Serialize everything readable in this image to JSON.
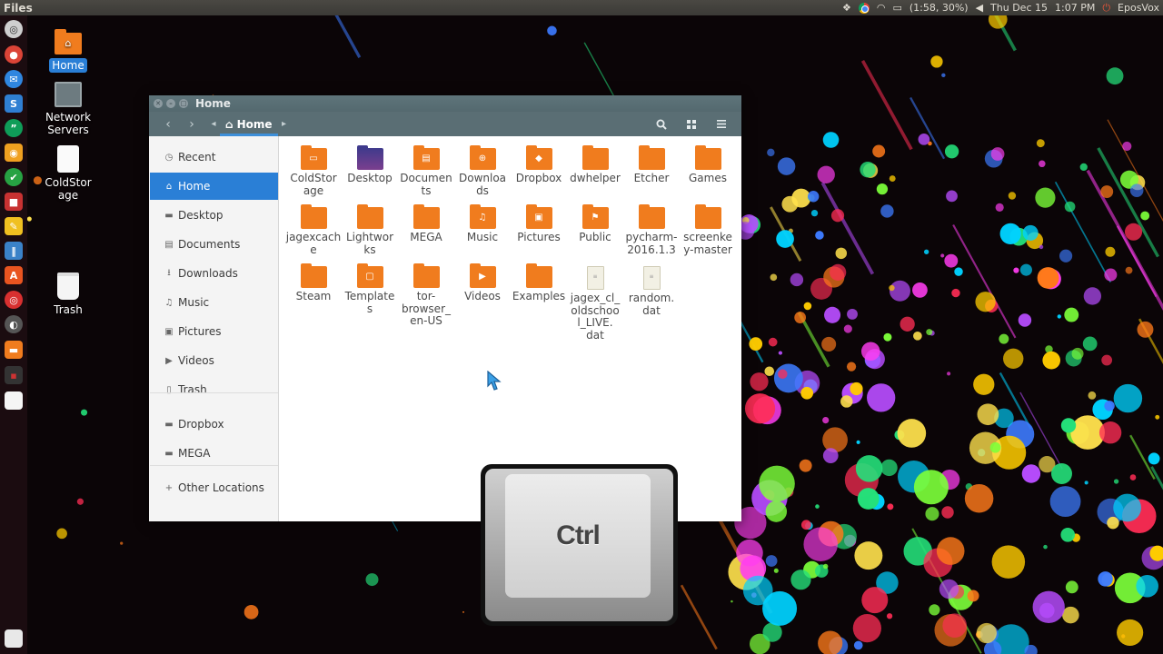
{
  "top_panel": {
    "app_name": "Files",
    "battery": "(1:58, 30%)",
    "date": "Thu Dec 15",
    "time": "1:07 PM",
    "user": "EposVox",
    "icons": [
      "dropbox-icon",
      "chrome-icon",
      "wifi-icon",
      "battery-icon",
      "volume-icon",
      "power-icon"
    ]
  },
  "desktop_icons": [
    {
      "label": "Home",
      "icon": "home-folder-icon"
    },
    {
      "label": "Network Servers",
      "icon": "network-icon"
    },
    {
      "label": "ColdStorage",
      "icon": "drive-icon"
    },
    {
      "label": "Trash",
      "icon": "trash-icon"
    }
  ],
  "window": {
    "title": "Home",
    "breadcrumb": "Home",
    "tool_icons": [
      "search-icon",
      "grid-view-icon",
      "menu-icon"
    ]
  },
  "sidebar": {
    "items": [
      {
        "label": "Recent",
        "icon": "recent-icon"
      },
      {
        "label": "Home",
        "icon": "home-icon"
      },
      {
        "label": "Desktop",
        "icon": "desktop-icon"
      },
      {
        "label": "Documents",
        "icon": "documents-icon"
      },
      {
        "label": "Downloads",
        "icon": "downloads-icon"
      },
      {
        "label": "Music",
        "icon": "music-icon"
      },
      {
        "label": "Pictures",
        "icon": "pictures-icon"
      },
      {
        "label": "Videos",
        "icon": "videos-icon"
      },
      {
        "label": "Trash",
        "icon": "trash-icon"
      },
      {
        "label": "Dropbox",
        "icon": "folder-icon"
      },
      {
        "label": "MEGA",
        "icon": "folder-icon"
      },
      {
        "label": "Other Locations",
        "icon": "plus-icon"
      }
    ],
    "active": "Home"
  },
  "files": [
    {
      "name": "ColdStorage",
      "type": "folder"
    },
    {
      "name": "Desktop",
      "type": "desktop"
    },
    {
      "name": "Documents",
      "type": "folder"
    },
    {
      "name": "Downloads",
      "type": "folder"
    },
    {
      "name": "Dropbox",
      "type": "folder"
    },
    {
      "name": "dwhelper",
      "type": "folder"
    },
    {
      "name": "Etcher",
      "type": "folder"
    },
    {
      "name": "Games",
      "type": "folder"
    },
    {
      "name": "jagexcache",
      "type": "folder"
    },
    {
      "name": "Lightworks",
      "type": "folder"
    },
    {
      "name": "MEGA",
      "type": "folder"
    },
    {
      "name": "Music",
      "type": "folder"
    },
    {
      "name": "Pictures",
      "type": "folder"
    },
    {
      "name": "Public",
      "type": "folder"
    },
    {
      "name": "pycharm-2016.1.3",
      "type": "folder"
    },
    {
      "name": "screenkey-master",
      "type": "folder"
    },
    {
      "name": "Steam",
      "type": "folder"
    },
    {
      "name": "Templates",
      "type": "folder"
    },
    {
      "name": "tor-browser_en-US",
      "type": "folder"
    },
    {
      "name": "Videos",
      "type": "folder"
    },
    {
      "name": "Examples",
      "type": "folder"
    },
    {
      "name": "jagex_cl_oldschool_LIVE.dat",
      "type": "file"
    },
    {
      "name": "random.dat",
      "type": "file"
    }
  ],
  "key_overlay": {
    "label": "Ctrl"
  },
  "colors": {
    "accent": "#2a7fd6",
    "folder": "#f07c1e",
    "headerbar": "#5a6e74"
  }
}
